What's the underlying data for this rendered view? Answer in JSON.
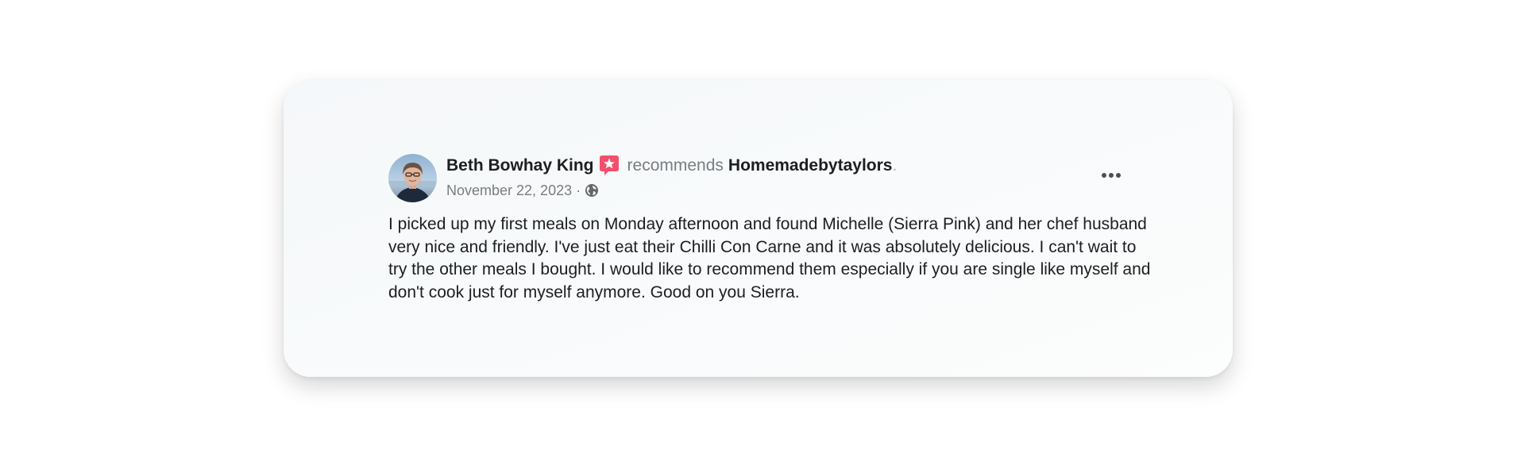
{
  "post": {
    "author": "Beth Bowhay King",
    "action": "recommends",
    "page_name": "Homemadebytaylors",
    "period": ".",
    "date": "November 22, 2023",
    "separator": "·",
    "privacy_icon": "globe-icon",
    "recommendation_icon": "recommend-star-icon",
    "more_icon": "more-options-icon",
    "review": "I picked up my first meals on Monday afternoon and found Michelle (Sierra Pink) and her chef husband very nice and friendly. I've just eat their Chilli Con Carne and it was absolutely delicious. I can't wait to try the other meals I bought. I would like to recommend them especially if you are single like myself and don't cook just for myself anymore. Good on you Sierra."
  },
  "colors": {
    "recommend_badge": "#f0506e",
    "text_primary": "#1c1e21",
    "text_secondary": "#7a7d82"
  }
}
